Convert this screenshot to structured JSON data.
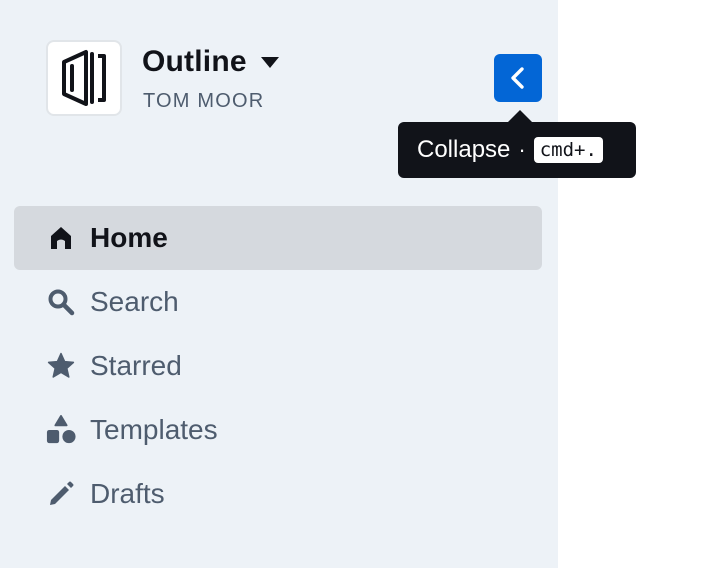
{
  "team": {
    "name": "Outline",
    "user": "TOM MOOR"
  },
  "tooltip": {
    "label": "Collapse",
    "separator": "·",
    "shortcut": "cmd+."
  },
  "nav": {
    "items": [
      {
        "label": "Home",
        "icon": "home-icon",
        "active": true
      },
      {
        "label": "Search",
        "icon": "search-icon",
        "active": false
      },
      {
        "label": "Starred",
        "icon": "star-icon",
        "active": false
      },
      {
        "label": "Templates",
        "icon": "shapes-icon",
        "active": false
      },
      {
        "label": "Drafts",
        "icon": "pencil-icon",
        "active": false
      }
    ]
  },
  "colors": {
    "sidebar_bg": "#edf2f7",
    "accent": "#0366d6",
    "tooltip_bg": "#111319",
    "active_item_bg": "#d5d9de",
    "muted_text": "#4e5c6e"
  }
}
